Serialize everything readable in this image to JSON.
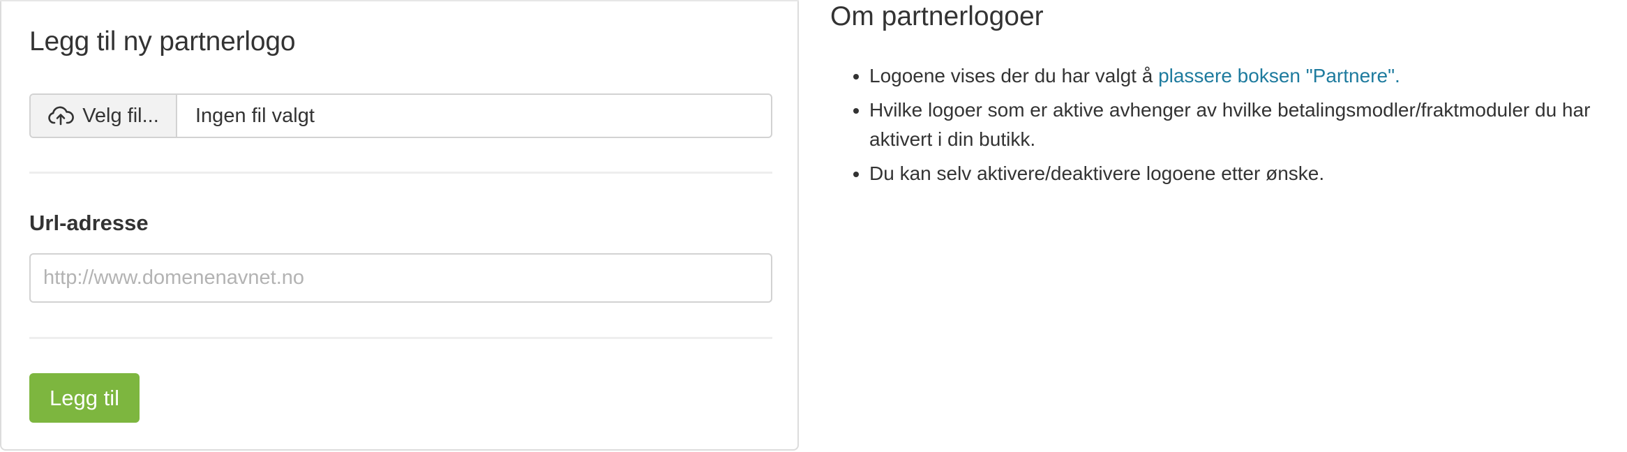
{
  "form": {
    "title": "Legg til ny partnerlogo",
    "file_button_label": "Velg fil...",
    "file_button_icon": "cloud-upload-icon",
    "file_status": "Ingen fil valgt",
    "url_label": "Url-adresse",
    "url_value": "",
    "url_placeholder": "http://www.domenenavnet.no",
    "submit_label": "Legg til"
  },
  "info": {
    "title": "Om partnerlogoer",
    "items": [
      {
        "text": "Logoene vises der du har valgt å ",
        "link": "plassere boksen \"Partnere\"."
      },
      {
        "text": "Hvilke logoer som er aktive avhenger av hvilke betalingsmodler/fraktmoduler du har aktivert i din butikk."
      },
      {
        "text": "Du kan selv aktivere/deaktivere logoene etter ønske."
      }
    ]
  },
  "colors": {
    "primary_button": "#7db63f",
    "link": "#1e7b9e",
    "text": "#333333",
    "placeholder": "#b3b3b3",
    "border": "#d2d2d2"
  }
}
